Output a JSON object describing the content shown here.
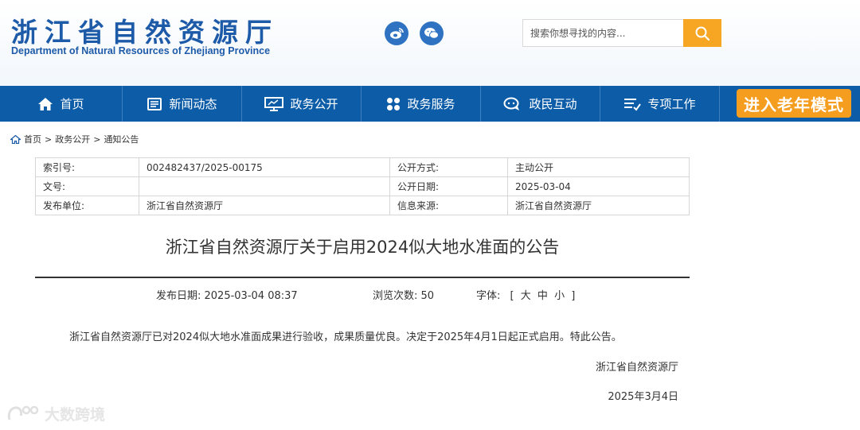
{
  "header": {
    "title_cn": "浙江省自然资源厅",
    "title_en": "Department of Natural Resources of Zhejiang Province",
    "social": [
      "weibo-icon",
      "wechat-icon"
    ],
    "search": {
      "placeholder": "搜索你想寻找的内容..."
    }
  },
  "nav": {
    "items": [
      {
        "label": "首页",
        "icon": "home-icon"
      },
      {
        "label": "新闻动态",
        "icon": "news-icon"
      },
      {
        "label": "政务公开",
        "icon": "monitor-icon"
      },
      {
        "label": "政务服务",
        "icon": "grid-icon"
      },
      {
        "label": "政民互动",
        "icon": "chat-icon"
      },
      {
        "label": "专项工作",
        "icon": "list-icon"
      }
    ],
    "elder_mode": "进入老年模式"
  },
  "breadcrumb": [
    "首页",
    "政务公开",
    "通知公告"
  ],
  "meta": {
    "index_label": "索引号:",
    "index_value": "002482437/2025-00175",
    "mode_label": "公开方式:",
    "mode_value": "主动公开",
    "doc_label": "文号:",
    "doc_value": "",
    "date_label": "公开日期:",
    "date_value": "2025-03-04",
    "unit_label": "发布单位:",
    "unit_value": "浙江省自然资源厅",
    "source_label": "信息来源:",
    "source_value": "浙江省自然资源厅"
  },
  "article": {
    "title": "浙江省自然资源厅关于启用2024似大地水准面的公告",
    "publish": "发布日期: 2025-03-04 08:37",
    "views": "浏览次数: 50",
    "font_label": "字体:",
    "font_open": "[",
    "font_large": "大",
    "font_medium": "中",
    "font_small": "小",
    "font_close": "]",
    "body": "浙江省自然资源厅已对2024似大地水准面成果进行验收，成果质量优良。决定于2025年4月1日起正式启用。特此公告。",
    "signature": "浙江省自然资源厅",
    "sign_date": "2025年3月4日"
  },
  "watermark": "大数跨境",
  "colors": {
    "brand_blue": "#0c5ca8",
    "accent_orange": "#f59d1f",
    "title_blue": "#1d5aa8"
  }
}
